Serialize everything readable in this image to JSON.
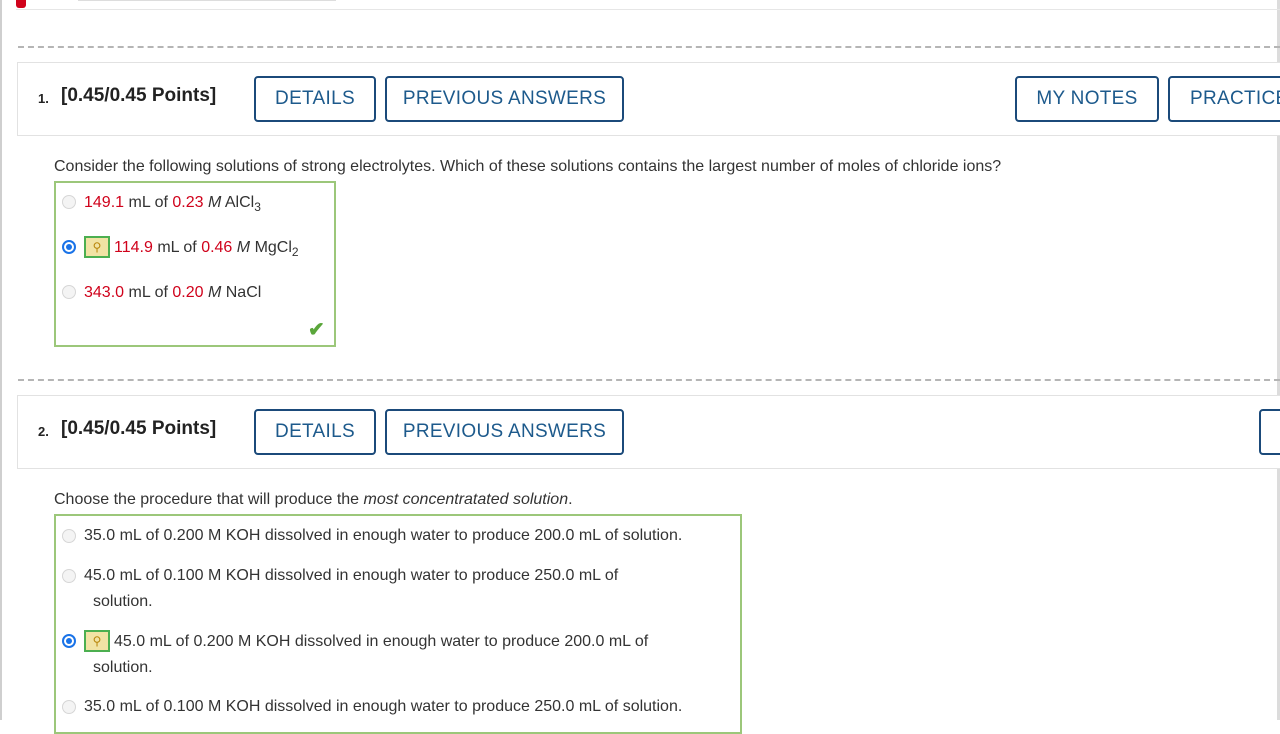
{
  "q1": {
    "number": "1.",
    "points": "[0.45/0.45 Points]",
    "buttons": {
      "details": "DETAILS",
      "previous": "PREVIOUS ANSWERS",
      "notes": "MY NOTES",
      "practice": "PRACTICE ANOTHER"
    },
    "question": "Consider the following solutions of strong electrolytes. Which of these solutions contains the largest number of moles of chloride ions?",
    "options": [
      {
        "volume": "149.1",
        "unit": "mL of",
        "conc": "0.23",
        "molar": "M",
        "formula": "AlCl",
        "sub": "3",
        "selected": false
      },
      {
        "volume": "114.9",
        "unit": "mL of",
        "conc": "0.46",
        "molar": "M",
        "formula": "MgCl",
        "sub": "2",
        "selected": true
      },
      {
        "volume": "343.0",
        "unit": "mL of",
        "conc": "0.20",
        "molar": "M",
        "formula": "NaCl",
        "sub": "",
        "selected": false
      }
    ],
    "correct_icon": "checkmark-icon"
  },
  "q2": {
    "number": "2.",
    "points": "[0.45/0.45 Points]",
    "buttons": {
      "details": "DETAILS",
      "previous": "PREVIOUS ANSWERS"
    },
    "question_prefix": "Choose the procedure that will produce the ",
    "question_emph": "most concentratated solution",
    "question_suffix": ".",
    "options": [
      {
        "line1": "35.0 mL of 0.200 M KOH dissolved in enough water to produce 200.0 mL of solution.",
        "line2": "",
        "selected": false
      },
      {
        "line1": "45.0 mL of 0.100 M KOH dissolved in enough water to produce 250.0 mL of",
        "line2": "solution.",
        "selected": false
      },
      {
        "line1": "45.0 mL of 0.200 M KOH dissolved in enough water to produce 200.0 mL of",
        "line2": "solution.",
        "selected": true
      },
      {
        "line1": "35.0 mL of 0.100 M KOH dissolved in enough water to produce 250.0 mL of solution.",
        "line2": "",
        "selected": false
      }
    ]
  },
  "icons": {
    "key": "key-icon",
    "radio": "radio-icon"
  },
  "colors": {
    "button_border": "#1b4a7a",
    "button_text": "#1d5a8c",
    "correct_border": "#9cc77a",
    "value_red": "#d0021b",
    "radio_selected": "#1a73e8"
  }
}
